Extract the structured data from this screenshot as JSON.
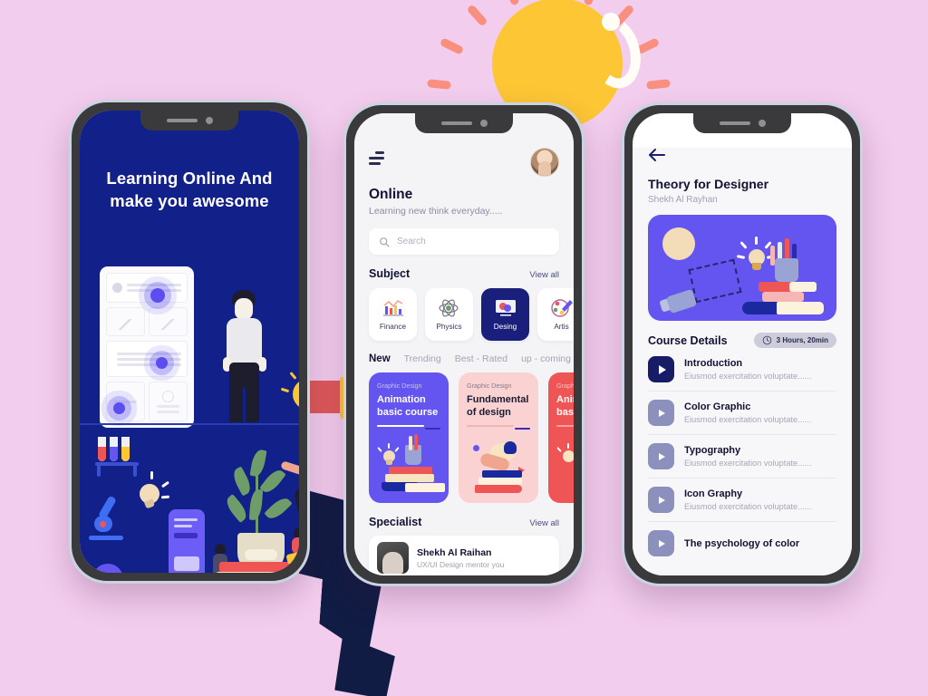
{
  "background_color": "#f3cdee",
  "decor": {
    "sun_color": "#fcc635",
    "ray_color": "#f98f7e",
    "highlight_color": "#fffdf6",
    "leg_color": "#111c44"
  },
  "phone1": {
    "name": "onboarding-screen",
    "bg_color": "#122089",
    "title_line1": "Learning Online And",
    "title_line2": "make you awesome"
  },
  "phone2": {
    "name": "home-screen",
    "menu_icon": "filter-menu-icon",
    "avatar": "user-avatar",
    "heading": "Online",
    "subheading": "Learning new think everyday.....",
    "search": {
      "placeholder": "Search",
      "icon": "search-icon"
    },
    "subject_section": {
      "title": "Subject",
      "view_all": "View all"
    },
    "subjects": [
      {
        "label": "Finance",
        "icon": "bar-chart-icon",
        "active": false
      },
      {
        "label": "Physics",
        "icon": "atom-icon",
        "active": false
      },
      {
        "label": "Desing",
        "icon": "design-monitor-icon",
        "active": true
      },
      {
        "label": "Artis",
        "icon": "palette-brush-icon",
        "active": false
      }
    ],
    "tabs": [
      {
        "label": "New",
        "active": true
      },
      {
        "label": "Trending",
        "active": false
      },
      {
        "label": "Best - Rated",
        "active": false
      },
      {
        "label": "up - coming",
        "active": false
      }
    ],
    "cards": [
      {
        "kicker": "Graphic Design",
        "title": "Animation basic course",
        "color": "#6455f0"
      },
      {
        "kicker": "Graphic Design",
        "title": "Fundamental of design",
        "color": "#fad2d2"
      },
      {
        "kicker": "Graphic Design",
        "title": "Animation basic course",
        "color": "#f05555"
      }
    ],
    "specialist_section": {
      "title": "Specialist",
      "view_all": "View all"
    },
    "specialist": {
      "name": "Shekh Al Raihan",
      "role": "UX/UI Design mentor you"
    }
  },
  "phone3": {
    "name": "course-details-screen",
    "back_icon": "arrow-left-icon",
    "course_title": "Theory for Designer",
    "author": "Shekh Al Rayhan",
    "hero_color": "#6455f0",
    "details_title": "Course Details",
    "duration_badge": {
      "icon": "clock-icon",
      "text": "3 Hours, 20min"
    },
    "lessons": [
      {
        "title": "Introduction",
        "desc": "Eiusmod exercitation voluptate......",
        "active": true
      },
      {
        "title": "Color Graphic",
        "desc": "Eiusmod exercitation voluptate......",
        "active": false
      },
      {
        "title": "Typography",
        "desc": "Eiusmod exercitation voluptate......",
        "active": false
      },
      {
        "title": "Icon Graphy",
        "desc": "Eiusmod exercitation voluptate......",
        "active": false
      },
      {
        "title": "The psychology of color",
        "desc": "",
        "active": false
      }
    ]
  }
}
